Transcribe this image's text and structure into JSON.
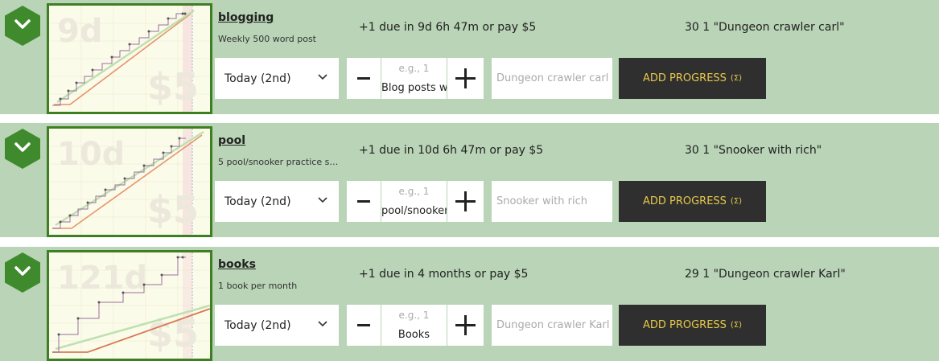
{
  "colors": {
    "row_bg": "#b9d4b6",
    "accent_green": "#3f8a2c",
    "button_bg": "#2f2f2f",
    "button_text": "#e8c94a"
  },
  "goals": [
    {
      "name": "blogging",
      "description": "Weekly 500 word post",
      "due_text": "+1 due in 9d 6h 47m or pay $5",
      "summary": "30 1 \"Dungeon crawler carl\"",
      "date_select": "Today (2nd)",
      "qty_placeholder": "e.g., 1",
      "unit": "Blog posts w",
      "note_placeholder": "Dungeon crawler carl",
      "add_label": "ADD PROGRESS",
      "sigma_label": "(Σ)",
      "thumb_days": "9d",
      "thumb_pay": "$5"
    },
    {
      "name": "pool",
      "description": "5 pool/snooker practice se...",
      "due_text": "+1 due in 10d 6h 47m or pay $5",
      "summary": "30 1 \"Snooker with rich\"",
      "date_select": "Today (2nd)",
      "qty_placeholder": "e.g., 1",
      "unit": "pool/snooker",
      "note_placeholder": "Snooker with rich",
      "add_label": "ADD PROGRESS",
      "sigma_label": "(Σ)",
      "thumb_days": "10d",
      "thumb_pay": "$5"
    },
    {
      "name": "books",
      "description": "1 book per month",
      "due_text": "+1 due in 4 months or pay $5",
      "summary": "29 1 \"Dungeon crawler Karl\"",
      "date_select": "Today (2nd)",
      "qty_placeholder": "e.g., 1",
      "unit": "Books",
      "note_placeholder": "Dungeon crawler Karl",
      "add_label": "ADD PROGRESS",
      "sigma_label": "(Σ)",
      "thumb_days": "121d",
      "thumb_pay": "$5"
    }
  ]
}
